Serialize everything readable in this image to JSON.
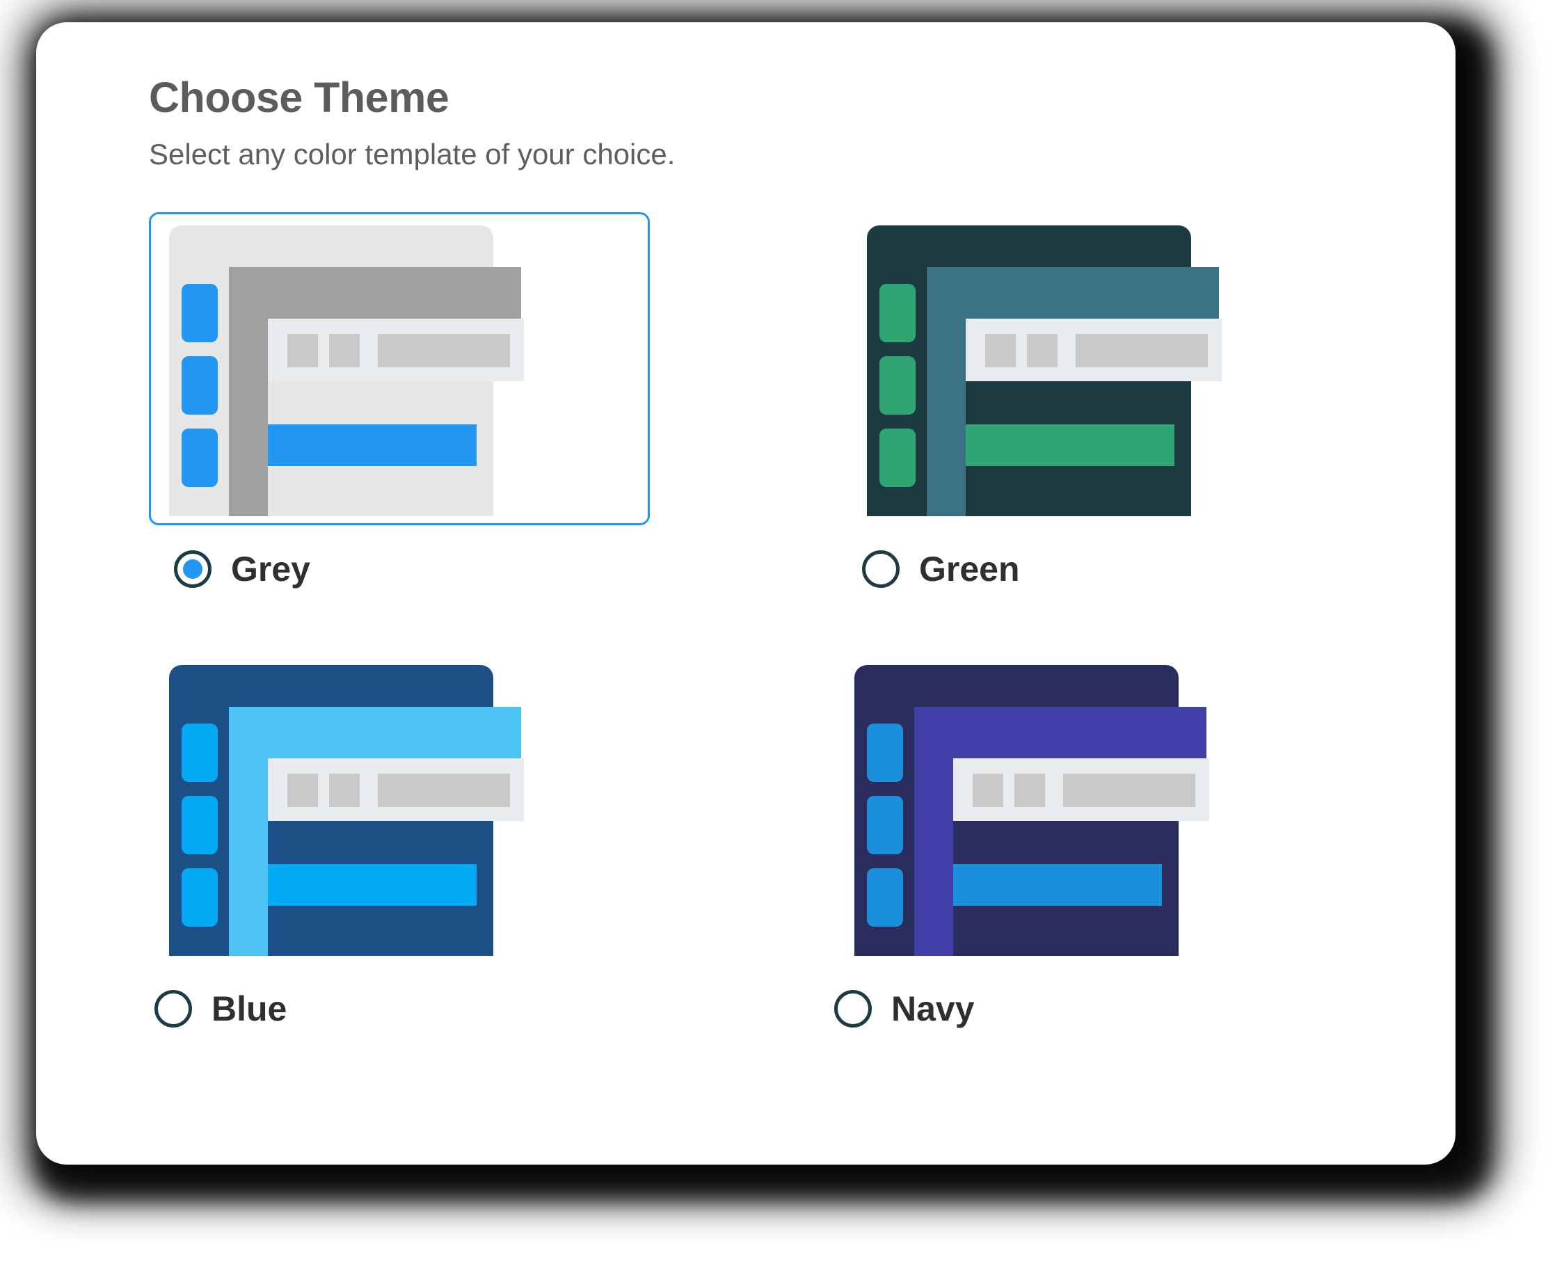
{
  "dialog": {
    "title": "Choose Theme",
    "subtitle": "Select any color template of your choice."
  },
  "selected_theme": "Grey",
  "themes": [
    {
      "id": "grey",
      "label": "Grey",
      "selected": true,
      "colors": {
        "panel": "#e6e6e6",
        "rail": "#a0a0a0",
        "topbar": "#a0a0a0",
        "navblock": "#2196f3",
        "toolbar": "#e9ecee",
        "chip": "#c9c9c9",
        "cta": "#2196f3",
        "frame_border": "#2196f3"
      }
    },
    {
      "id": "green",
      "label": "Green",
      "selected": false,
      "colors": {
        "panel": "#1b3b40",
        "rail": "#3a7183",
        "topbar": "#3a7183",
        "navblock": "#30a473",
        "toolbar": "#e9ecee",
        "chip": "#c9c9c9",
        "cta": "#30a473",
        "frame_border": "transparent"
      }
    },
    {
      "id": "blue",
      "label": "Blue",
      "selected": false,
      "colors": {
        "panel": "#1d4f87",
        "rail": "#4cc3f2",
        "topbar": "#4cc3f2",
        "navblock": "#03a9f4",
        "toolbar": "#e9ecee",
        "chip": "#c9c9c9",
        "cta": "#03a9f4",
        "frame_border": "transparent"
      }
    },
    {
      "id": "navy",
      "label": "Navy",
      "selected": false,
      "colors": {
        "panel": "#2b2c5e",
        "rail": "#4040a8",
        "topbar": "#4040a8",
        "navblock": "#1a8fdc",
        "toolbar": "#e9ecee",
        "chip": "#c9c9c9",
        "cta": "#1a8fdc",
        "frame_border": "transparent"
      }
    }
  ],
  "accent": {
    "selection_blue": "#2196f3",
    "radio_ring": "#1d3b44",
    "title_grey": "#5c5c5c",
    "label_dark": "#2f2f2f"
  }
}
